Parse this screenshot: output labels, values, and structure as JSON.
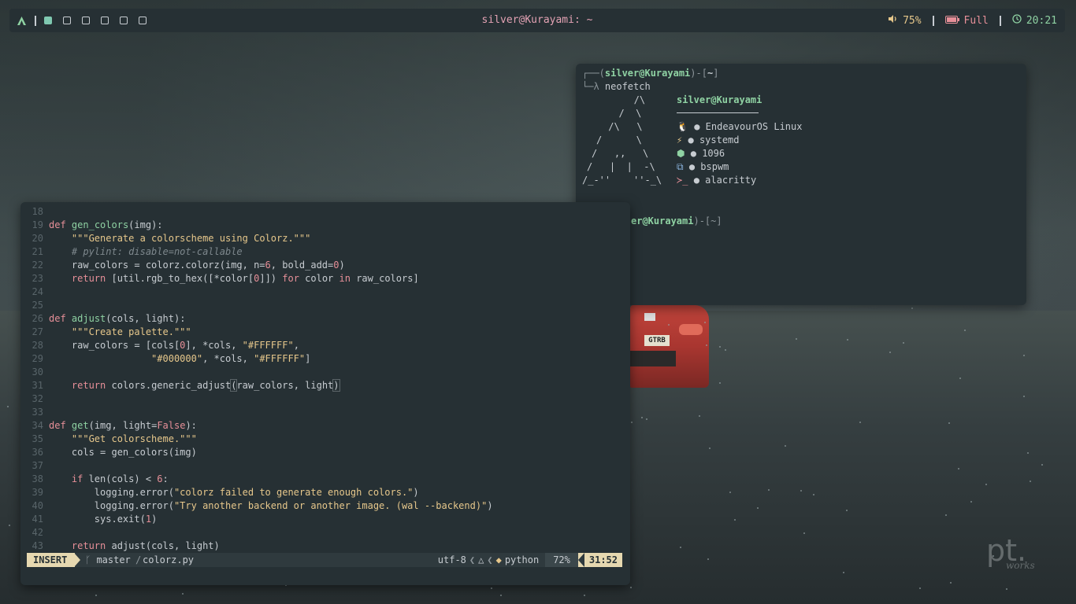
{
  "topbar": {
    "title": "silver@Kurayami: ~",
    "volume": "75%",
    "battery": "Full",
    "clock": "20:21",
    "workspaces": [
      "1",
      "2",
      "3",
      "4",
      "5",
      "6"
    ]
  },
  "terminal": {
    "prompt_user": "silver@Kurayami",
    "prompt_dir": "~",
    "prompt_open": "┌──(",
    "prompt_mid": ")-[",
    "prompt_close": "]",
    "cmd_prefix": "└─λ ",
    "command": "neofetch",
    "neofetch_title": "silver@Kurayami",
    "ascii": [
      "   /\\",
      "  /  \\",
      " /\\   \\",
      "/      \\",
      "/   ,,   \\",
      "/   |  |  -\\",
      "/_-''    ''-_\\"
    ],
    "info": [
      {
        "icon": "linux-icon",
        "glyph": "🐧",
        "value": "EndeavourOS Linux"
      },
      {
        "icon": "init-icon",
        "glyph": "⚡",
        "value": "systemd"
      },
      {
        "icon": "package-icon",
        "glyph": "⬢",
        "value": "1096"
      },
      {
        "icon": "wm-icon",
        "glyph": "⧉",
        "value": "bspwm"
      },
      {
        "icon": "terminal-icon",
        "glyph": "≻_",
        "value": "alacritty"
      }
    ],
    "second_prompt_visible": "er@Kurayami",
    "second_prompt_rest": ")-[~]"
  },
  "editor": {
    "lines": [
      {
        "n": "18",
        "html": ""
      },
      {
        "n": "19",
        "html": "<span class='kw'>def</span> <span class='fn'>gen_colors</span>(img):"
      },
      {
        "n": "20",
        "html": "    <span class='st'>\"\"\"Generate a colorscheme using Colorz.\"\"\"</span>"
      },
      {
        "n": "21",
        "html": "    <span class='cm'># pylint: disable=not-callable</span>"
      },
      {
        "n": "22",
        "html": "    raw_colors = colorz.colorz(img, n=<span class='nm'>6</span>, bold_add=<span class='nm'>0</span>)"
      },
      {
        "n": "23",
        "html": "    <span class='kw'>return</span> [util.rgb_to_hex([*color[<span class='nm'>0</span>]]) <span class='kw'>for</span> color <span class='kw'>in</span> raw_colors]"
      },
      {
        "n": "24",
        "html": ""
      },
      {
        "n": "25",
        "html": ""
      },
      {
        "n": "26",
        "html": "<span class='kw'>def</span> <span class='fn'>adjust</span>(cols, light):"
      },
      {
        "n": "27",
        "html": "    <span class='st'>\"\"\"Create palette.\"\"\"</span>"
      },
      {
        "n": "28",
        "html": "    raw_colors = [cols[<span class='nm'>0</span>], *cols, <span class='st'>\"#FFFFFF\"</span>,"
      },
      {
        "n": "29",
        "html": "                  <span class='st'>\"#000000\"</span>, *cols, <span class='st'>\"#FFFFFF\"</span>]"
      },
      {
        "n": "30",
        "html": ""
      },
      {
        "n": "31",
        "html": "    <span class='kw'>return</span> colors.generic_adjust<span class='paren'>(</span>raw_colors, light<span class='paren'>)</span><span class='cursor'></span>"
      },
      {
        "n": "32",
        "html": ""
      },
      {
        "n": "33",
        "html": ""
      },
      {
        "n": "34",
        "html": "<span class='kw'>def</span> <span class='fn'>get</span>(img, light=<span class='nm'>False</span>):"
      },
      {
        "n": "35",
        "html": "    <span class='st'>\"\"\"Get colorscheme.\"\"\"</span>"
      },
      {
        "n": "36",
        "html": "    cols = gen_colors(img)"
      },
      {
        "n": "37",
        "html": ""
      },
      {
        "n": "38",
        "html": "    <span class='kw'>if</span> len(cols) &lt; <span class='nm'>6</span>:"
      },
      {
        "n": "39",
        "html": "        logging.error(<span class='st'>\"colorz failed to generate enough colors.\"</span>)"
      },
      {
        "n": "40",
        "html": "        logging.error(<span class='st'>\"Try another backend or another image. (wal --backend)\"</span>)"
      },
      {
        "n": "41",
        "html": "        sys.exit(<span class='nm'>1</span>)"
      },
      {
        "n": "42",
        "html": ""
      },
      {
        "n": "43",
        "html": "    <span class='kw'>return</span> adjust(cols, light)"
      }
    ],
    "status": {
      "mode": "INSERT",
      "branch": "master",
      "file": "colorz.py",
      "encoding": "utf-8",
      "filetype": "python",
      "percent": "72%",
      "position": "31:52"
    }
  },
  "wallpaper": {
    "plate": "GTRB",
    "watermark": "pt.",
    "watermark_sub": "works"
  },
  "colors": {
    "bg": "#263034",
    "green": "#8fd2a3",
    "pink": "#e3a2b4",
    "yellow": "#e6c78b",
    "red": "#e68f98"
  }
}
